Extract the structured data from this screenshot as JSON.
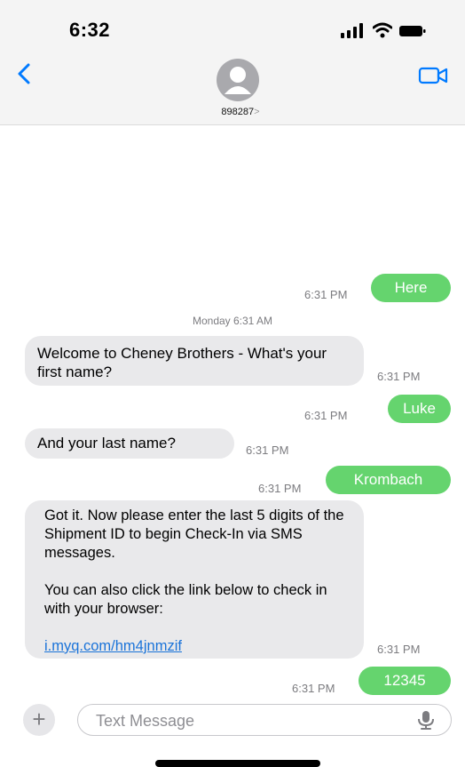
{
  "status_bar": {
    "time": "6:32"
  },
  "header": {
    "contact": "898287",
    "contact_chevron": ">"
  },
  "messages": {
    "m1": {
      "text": "Here",
      "time": "6:31 PM"
    },
    "day_label": "Monday 6:31 AM",
    "m2": {
      "text": "Welcome to Cheney Brothers - What's your first name?",
      "time": "6:31 PM"
    },
    "m3": {
      "text": "Luke",
      "time": "6:31 PM"
    },
    "m4": {
      "text": "And your last name?",
      "time": "6:31 PM"
    },
    "m5": {
      "text": "Krombach",
      "time": "6:31 PM"
    },
    "m6": {
      "para1": "Got it. Now please enter the last 5 digits of the Shipment ID to begin Check-In via SMS messages.",
      "para2": "You can also click the link below to check in with your browser:",
      "link": "i.myq.com/hm4jnmzif",
      "time": "6:31 PM"
    },
    "m7": {
      "text": "12345",
      "time": "6:31 PM"
    }
  },
  "compose": {
    "plus": "+",
    "placeholder": "Text Message"
  },
  "icons": {
    "back": "chevron-left-icon",
    "video": "video-camera-icon",
    "avatar": "person-icon",
    "mic": "microphone-icon",
    "signal": "cellular-signal-icon",
    "wifi": "wifi-icon",
    "battery": "battery-icon"
  },
  "colors": {
    "accent": "#007aff",
    "sent_bubble": "#65d46e",
    "received_bubble": "#e9e9eb",
    "link": "#1a73d9"
  }
}
